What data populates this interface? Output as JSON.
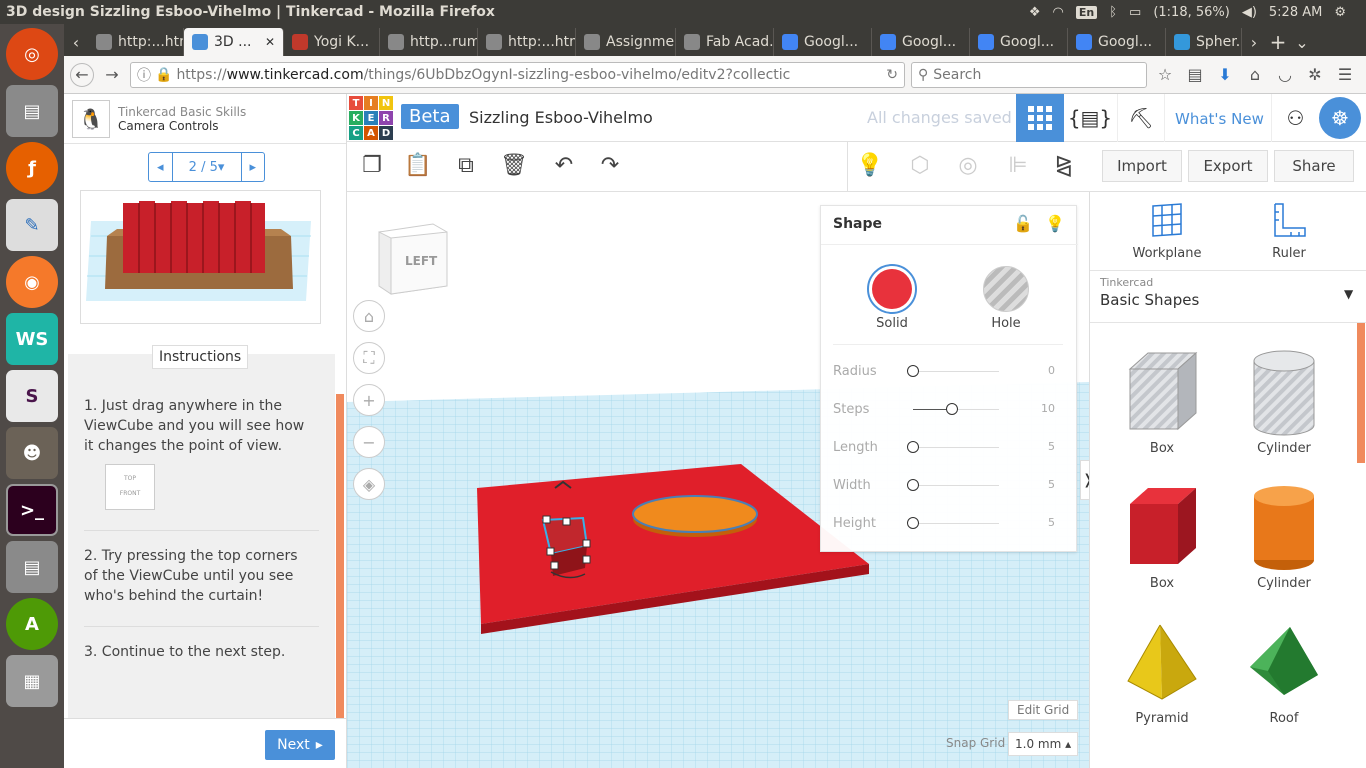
{
  "os": {
    "window_title": "3D design Sizzling Esboo-Vihelmo | Tinkercad - Mozilla Firefox",
    "keyboard_layout": "En",
    "battery": "(1:18, 56%)",
    "clock": "5:28 AM",
    "launcher_icons": [
      "ubuntu-icon",
      "files-icon",
      "firefox-icon",
      "libreoffice-icon",
      "blender-icon",
      "webstorm-icon",
      "slack-icon",
      "gimp-icon",
      "terminal-icon",
      "files-icon",
      "software-updater-icon",
      "workspace-icon"
    ]
  },
  "browser": {
    "tabs": [
      {
        "label": "http:...html",
        "color": "#888"
      },
      {
        "label": "3D ...",
        "color": "#4a90d9"
      },
      {
        "label": "Yogi K...",
        "color": "#c0392b"
      },
      {
        "label": "http...rum/",
        "color": "#888"
      },
      {
        "label": "http:...html",
        "color": "#888"
      },
      {
        "label": "Assignme...",
        "color": "#888"
      },
      {
        "label": "Fab Acad...",
        "color": "#888"
      },
      {
        "label": "Googl...",
        "color": "#4285f4"
      },
      {
        "label": "Googl...",
        "color": "#4285f4"
      },
      {
        "label": "Googl...",
        "color": "#4285f4"
      },
      {
        "label": "Googl...",
        "color": "#4285f4"
      },
      {
        "label": "Spher...",
        "color": "#3498db"
      }
    ],
    "url_prefix": "https://",
    "url_domain": "www.tinkercad.com",
    "url_path": "/things/6UbDbzOgynI-sizzling-esboo-vihelmo/editv2?collectic",
    "search_placeholder": "Search"
  },
  "lesson": {
    "category": "Tinkercad Basic Skills",
    "name": "Camera Controls",
    "page": "2 / 5",
    "instructions_title": "Instructions",
    "steps": [
      "1. Just drag anywhere in the ViewCube and you will see how it changes the point of view.",
      "2. Try pressing the top corners of the ViewCube until you see who's behind the curtain!",
      "3. Continue to the next step."
    ],
    "viewcube_thumb_top": "TOP",
    "viewcube_thumb_front": "FRONT",
    "next_label": "Next"
  },
  "header": {
    "logo_letters": [
      "TIN",
      "KER",
      "CAD"
    ],
    "beta": "Beta",
    "design_title": "Sizzling Esboo-Vihelmo",
    "save_status": "All changes saved",
    "whats_new": "What's New"
  },
  "toolbar": {
    "import": "Import",
    "export": "Export",
    "share": "Share"
  },
  "viewcube": {
    "face_label": "LEFT"
  },
  "shape_panel": {
    "title": "Shape",
    "solid": "Solid",
    "hole": "Hole",
    "solid_color": "#e8323c",
    "params": [
      {
        "label": "Radius",
        "value": "0",
        "fraction": 0
      },
      {
        "label": "Steps",
        "value": "10",
        "fraction": 0.45
      },
      {
        "label": "Length",
        "value": "5",
        "fraction": 0
      },
      {
        "label": "Width",
        "value": "5",
        "fraction": 0
      },
      {
        "label": "Height",
        "value": "5",
        "fraction": 0
      }
    ]
  },
  "right_panel": {
    "workplane": "Workplane",
    "ruler": "Ruler",
    "library_source": "Tinkercad",
    "library_name": "Basic Shapes",
    "shapes": [
      {
        "label": "Box",
        "kind": "box-hole"
      },
      {
        "label": "Cylinder",
        "kind": "cyl-hole"
      },
      {
        "label": "Box",
        "kind": "box-red"
      },
      {
        "label": "Cylinder",
        "kind": "cyl-orange"
      },
      {
        "label": "Pyramid",
        "kind": "pyramid"
      },
      {
        "label": "Roof",
        "kind": "roof"
      }
    ]
  },
  "grid_controls": {
    "edit_grid": "Edit Grid",
    "snap_label": "Snap Grid",
    "snap_value": "1.0 mm ▴"
  }
}
